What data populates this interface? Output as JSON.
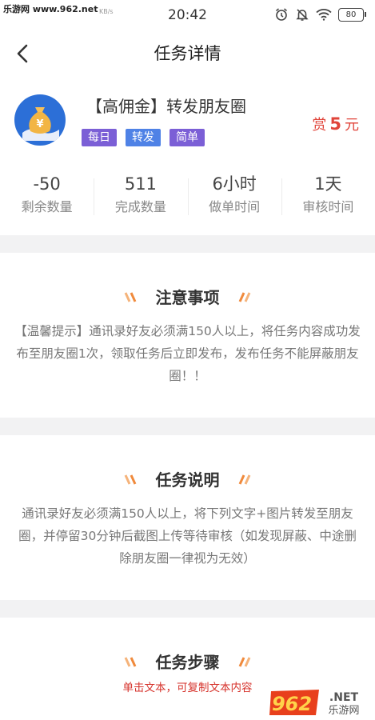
{
  "watermark_top": "乐游网 www.962.net",
  "status": {
    "speed": "KB/s",
    "time": "20:42",
    "battery": "80"
  },
  "nav": {
    "title": "任务详情"
  },
  "task": {
    "title": "【高佣金】转发朋友圈",
    "tags": [
      "每日",
      "转发",
      "简单"
    ],
    "reward_prefix": "赏",
    "reward_value": "5",
    "reward_unit": "元",
    "stats": [
      {
        "value": "-50",
        "label": "剩余数量"
      },
      {
        "value": "511",
        "label": "完成数量"
      },
      {
        "value": "6小时",
        "label": "做单时间"
      },
      {
        "value": "1天",
        "label": "审核时间"
      }
    ]
  },
  "notice": {
    "title": "注意事项",
    "body": "【温馨提示】通讯录好友必须满150人以上，将任务内容成功发布至朋友圈1次，领取任务后立即发布，发布任务不能屏蔽朋友圈！！"
  },
  "description": {
    "title": "任务说明",
    "body": "通讯录好友必须满150人以上，将下列文字+图片转发至朋友圈，并停留30分钟后截图上传等待审核（如发现屏蔽、中途删除朋友圈一律视为无效）"
  },
  "steps": {
    "title": "任务步骤",
    "subtitle": "单击文本，可复制文本内容"
  },
  "watermark_bottom": {
    "number": "962",
    "suffix": ".NET",
    "cn": "乐游网"
  },
  "colors": {
    "accent_red": "#e0443a",
    "tag_purple": "#7b5fd6",
    "tag_blue": "#4f82e6",
    "deco_orange": "#f08a3c"
  }
}
